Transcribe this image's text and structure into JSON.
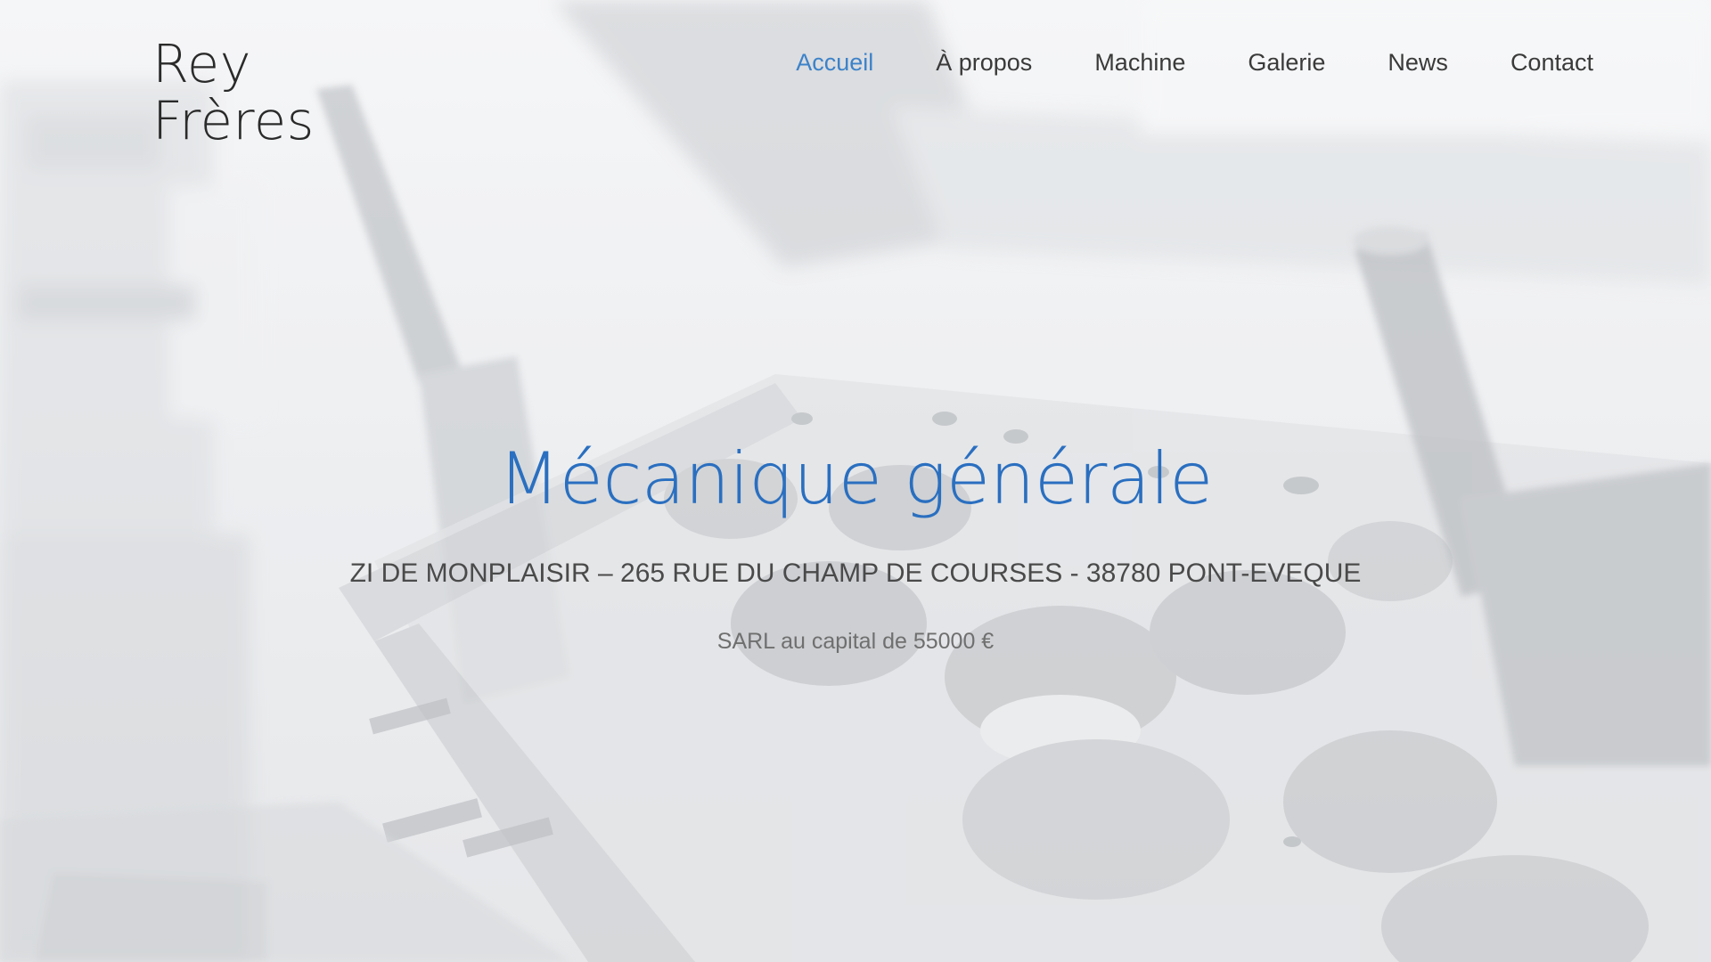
{
  "header": {
    "logo_line1": "Rey",
    "logo_line2": "Frères"
  },
  "nav": {
    "items": [
      {
        "label": "Accueil",
        "active": true
      },
      {
        "label": "À propos",
        "active": false
      },
      {
        "label": "Machine",
        "active": false
      },
      {
        "label": "Galerie",
        "active": false
      },
      {
        "label": "News",
        "active": false
      },
      {
        "label": "Contact",
        "active": false
      }
    ]
  },
  "hero": {
    "title": "Mécanique générale",
    "address": "ZI DE MONPLAISIR – 265 RUE DU CHAMP DE COURSES - 38780 PONT-EVEQUE",
    "capital": "SARL au capital de 55000 €",
    "background_image": "engine-cylinder-head-photo"
  },
  "colors": {
    "accent": "#2a6fc0",
    "nav_active": "#3d82c9",
    "text": "#3a3a3a"
  }
}
